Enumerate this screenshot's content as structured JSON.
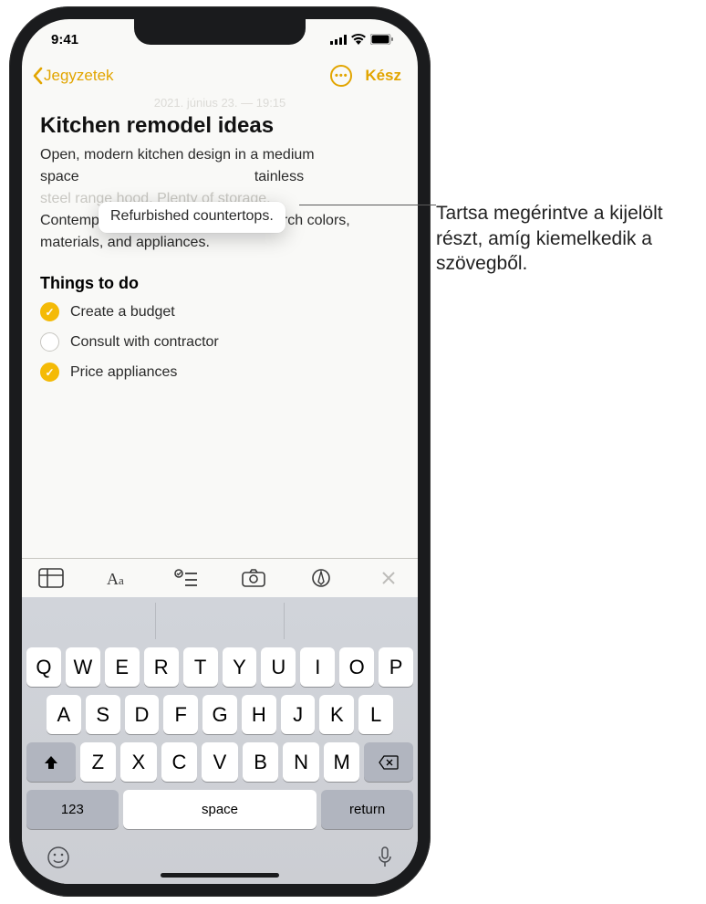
{
  "status": {
    "time": "9:41"
  },
  "nav": {
    "back": "Jegyzetek",
    "done": "Kész"
  },
  "note": {
    "date": "2021. június 23. — 19:15",
    "title": "Kitchen remodel ideas",
    "body_line1": "Open, modern kitchen design in a medium",
    "body_line2a": "space",
    "body_line2b": "tainless",
    "body_line3": "steel range hood. Plenty of storage.",
    "body_line4": "Contemporary lighting. Need to research colors, materials, and appliances.",
    "float_text": "Refurbished countertops.",
    "section": "Things to do",
    "items": [
      {
        "label": "Create a budget",
        "checked": true
      },
      {
        "label": "Consult with contractor",
        "checked": false
      },
      {
        "label": "Price appliances",
        "checked": true
      }
    ]
  },
  "keyboard": {
    "row1": [
      "Q",
      "W",
      "E",
      "R",
      "T",
      "Y",
      "U",
      "I",
      "O",
      "P"
    ],
    "row2": [
      "A",
      "S",
      "D",
      "F",
      "G",
      "H",
      "J",
      "K",
      "L"
    ],
    "row3": [
      "Z",
      "X",
      "C",
      "V",
      "B",
      "N",
      "M"
    ],
    "num": "123",
    "space": "space",
    "return": "return"
  },
  "callout": "Tartsa megérintve a kijelölt részt, amíg kiemelkedik a szövegből."
}
